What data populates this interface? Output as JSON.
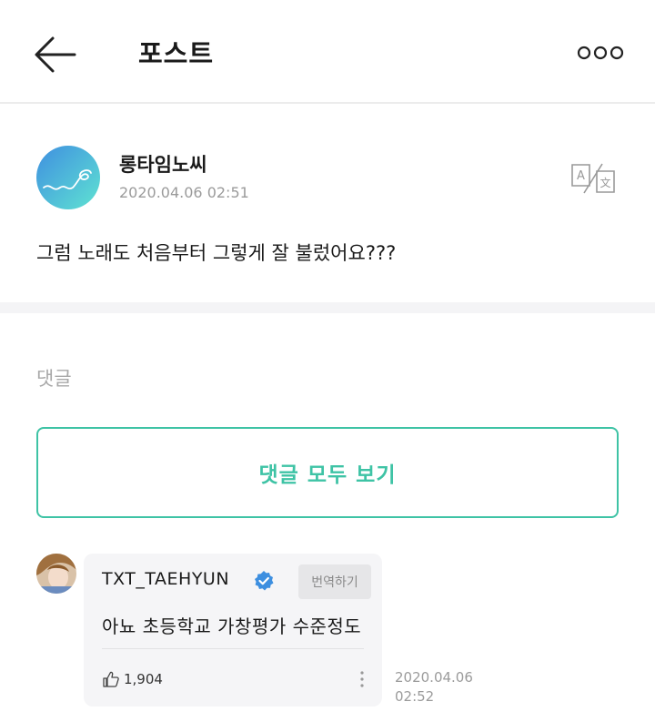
{
  "header": {
    "title": "포스트",
    "back_icon": "arrow-left-icon",
    "more_icon": "more-horizontal-icon"
  },
  "post": {
    "author": "롱타임노씨",
    "timestamp": "2020.04.06 02:51",
    "body": "그럼 노래도 처음부터 그렇게 잘 불렀어요???",
    "translate_icon": "translate-icon"
  },
  "comments": {
    "section_label": "댓글",
    "view_all_label": "댓글 모두 보기",
    "items": [
      {
        "author": "TXT_TAEHYUN",
        "verified_icon": "verified-badge-icon",
        "translate_label": "번역하기",
        "text": "아뇨 초등학교 가창평가 수준정도",
        "like_icon": "thumbs-up-icon",
        "likes": "1,904",
        "date": "2020.04.06",
        "time": "02:52"
      }
    ]
  },
  "colors": {
    "accent": "#3ec3a5",
    "muted_text": "#9b9b9b",
    "verified": "#3d8fe0"
  }
}
